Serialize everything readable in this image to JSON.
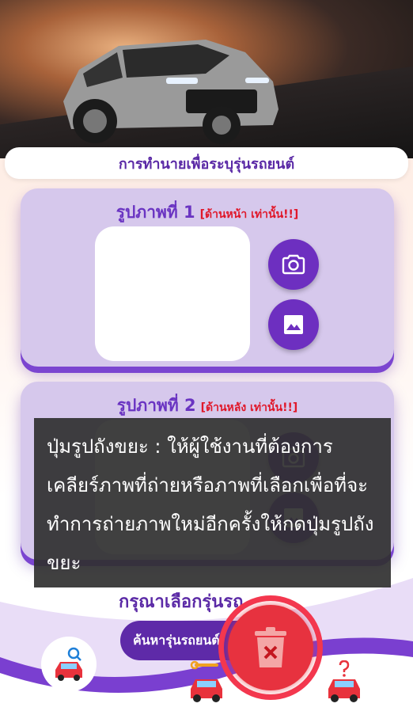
{
  "header": {
    "title": "การทำนายเพื่อระบุรุ่นรถยนต์"
  },
  "cards": [
    {
      "title": "รูปภาพที่ 1",
      "note": "[ด้านหน้า เท่านั้น!!]"
    },
    {
      "title": "รูปภาพที่ 2",
      "note": "[ด้านหลัง เท่านั้น!!]"
    }
  ],
  "bottom": {
    "choose_label": "กรุณาเลือกรุ่นรถ",
    "search_label": "ค้นหารุ่นรถยนต์"
  },
  "tooltip": {
    "text": "ปุ่มรูปถังขยะ : ให้ผู้ใช้งานที่ต้องการเคลียร์ภาพที่ถ่ายหรือภาพที่เลือกเพื่อที่จะทำการถ่ายภาพใหม่อีกครั้งให้กดปุ่มรูปถังขยะ"
  },
  "icons": {
    "camera": "camera-icon",
    "gallery": "image-icon",
    "trash": "trash-icon",
    "search_car": "search-car-icon",
    "repair_car": "repair-car-icon",
    "help_car": "help-car-icon"
  },
  "colors": {
    "primary": "#6d2fc0",
    "card_bg": "#d6c8ec",
    "warning_text": "#e0182a",
    "trash_red": "#e7323f",
    "highlight_ring": "#f4384f"
  }
}
